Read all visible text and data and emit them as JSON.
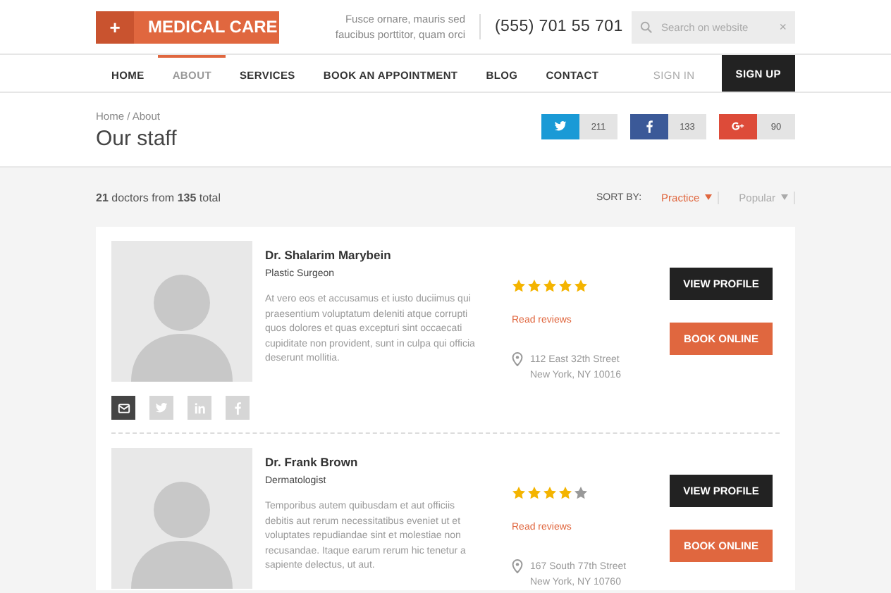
{
  "logo": {
    "icon": "+",
    "text": "MEDICAL CARE"
  },
  "tagline": "Fusce ornare, mauris sed faucibus porttitor, quam orci",
  "phone": "(555) 701 55 701",
  "search": {
    "placeholder": "Search on website",
    "clear": "×"
  },
  "nav": [
    {
      "label": "HOME",
      "selected": false
    },
    {
      "label": "ABOUT",
      "selected": true
    },
    {
      "label": "SERVICES",
      "selected": false
    },
    {
      "label": "BOOK AN APPOINTMENT",
      "selected": false
    },
    {
      "label": "BLOG",
      "selected": false
    },
    {
      "label": "CONTACT",
      "selected": false
    }
  ],
  "auth": [
    {
      "label": "SIGN IN",
      "kind": "link"
    },
    {
      "label": "SIGN UP",
      "kind": "button"
    }
  ],
  "breadcrumb": "Home / About",
  "page_title": "Our staff",
  "shares": [
    {
      "kind": "twitter",
      "count": "211"
    },
    {
      "kind": "facebook",
      "count": "133"
    },
    {
      "kind": "googleplus",
      "count": "90"
    }
  ],
  "summary": "**21** doctors from **135** total",
  "sort": {
    "label": "SORT BY:",
    "options": [
      {
        "label": "Practice",
        "selected": true
      },
      {
        "label": "Popular",
        "selected": false
      }
    ]
  },
  "doctors": [
    {
      "name": "Dr. Shalarim Marybein",
      "specialty": "Plastic Surgeon",
      "bio": "At vero eos et accusamus et iusto duciimus qui praesentium voluptatum deleniti atque corrupti quos dolores et quas excepturi sint occaecati cupiditate non provident, sunt in culpa qui officia deserunt mollitia.",
      "stars": 5,
      "reviews_link": "Read reviews",
      "address_lines": [
        "112 East 32th Street",
        "New York, NY 10016"
      ],
      "view_button": "VIEW PROFILE",
      "book_button": "BOOK ONLINE",
      "social": [
        {
          "kind": "email",
          "selected": true
        },
        {
          "kind": "twitter",
          "selected": false
        },
        {
          "kind": "linkedin",
          "selected": false
        },
        {
          "kind": "facebook",
          "selected": false
        }
      ]
    },
    {
      "name": "Dr. Frank Brown",
      "specialty": "Dermatologist",
      "bio": "Temporibus autem quibusdam et aut officiis debitis aut rerum necessitatibus eveniet ut et voluptates repudiandae sint et molestiae non recusandae. Itaque earum rerum hic tenetur a sapiente delectus, ut aut.",
      "stars": 4,
      "reviews_link": "Read reviews",
      "address_lines": [
        "167 South 77th Street",
        "New York, NY 10760"
      ],
      "view_button": "VIEW PROFILE",
      "book_button": "BOOK ONLINE"
    }
  ]
}
